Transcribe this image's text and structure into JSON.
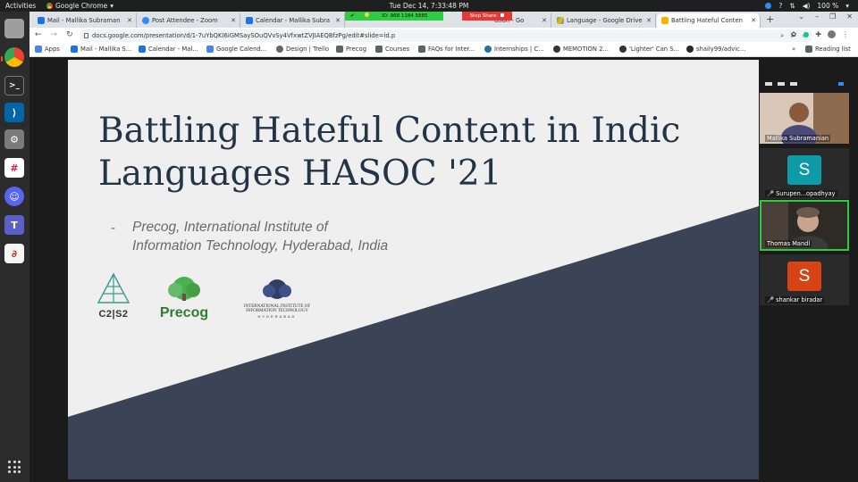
{
  "system_bar": {
    "activities": "Activities",
    "app_name": "Google Chrome",
    "clock": "Tue Dec 14,  7:33:48 PM",
    "battery": "100 %"
  },
  "tabs": [
    {
      "label": "Mail - Mallika Subraman",
      "color": "#1a73e8"
    },
    {
      "label": "Post Attendee - Zoom",
      "color": "#2d8cff"
    },
    {
      "label": "Calendar - Mallika Subra",
      "color": "#1a73e8"
    },
    {
      "label": "ation - Go",
      "color": "#f4b400"
    },
    {
      "label": "Language - Google Drive",
      "color": "#34a853"
    },
    {
      "label": "Battling Hateful Conten",
      "color": "#f4b400"
    }
  ],
  "zoom_share": {
    "meeting_id": "ID: 968 1184 5885",
    "stop_share": "Stop Share"
  },
  "address_bar": {
    "url": "docs.google.com/presentation/d/1-7uYbQKI6iGMSaySOuQVvSy4VfxwtZVJIAEQBfzPg/edit#slide=id.p"
  },
  "bookmarks": [
    {
      "label": "Apps",
      "color": "#4285f4"
    },
    {
      "label": "Mail - Mallika S...",
      "color": "#1a73e8"
    },
    {
      "label": "Calendar - Mal...",
      "color": "#1a73e8"
    },
    {
      "label": "Google Calend...",
      "color": "#4285f4"
    },
    {
      "label": "Design | Trello",
      "color": "#333333"
    },
    {
      "label": "Precog",
      "color": "#555555"
    },
    {
      "label": "Courses",
      "color": "#555555"
    },
    {
      "label": "FAQs for Inter...",
      "color": "#555555"
    },
    {
      "label": "Internships | C...",
      "color": "#21759b"
    },
    {
      "label": "MEMOTION 2...",
      "color": "#333333"
    },
    {
      "label": "'Lighter' Can S...",
      "color": "#333333"
    },
    {
      "label": "shaily99/advic...",
      "color": "#24292e"
    }
  ],
  "bookmarks_more": "»",
  "reading_list": "Reading list",
  "slide": {
    "title": "Battling Hateful Content in Indic Languages HASOC '21",
    "dash": "-",
    "subtitle_line1": "Precog, International Institute of",
    "subtitle_line2": "Information Technology, Hyderabad, India",
    "logos": {
      "c2s2": "C2|S2",
      "precog": "Precog",
      "iiit_line1": "INTERNATIONAL INSTITUTE OF",
      "iiit_line2": "INFORMATION TECHNOLOGY",
      "iiit_line3": "HYDERABAD"
    }
  },
  "participants": [
    {
      "name": "Mallika Subramanian",
      "type": "video",
      "muted": false
    },
    {
      "name": "Surupen...opadhyay",
      "type": "avatar",
      "initial": "S",
      "color": "#0e9aa7",
      "muted": true
    },
    {
      "name": "Thomas Mandl",
      "type": "video",
      "muted": false,
      "active": true
    },
    {
      "name": "shankar biradar",
      "type": "avatar",
      "initial": "S",
      "color": "#d84315",
      "muted": true
    }
  ]
}
